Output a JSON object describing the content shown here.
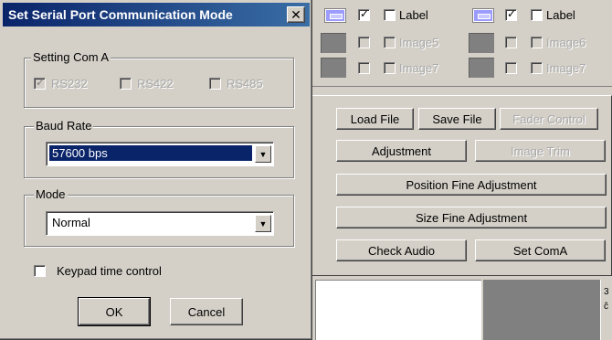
{
  "dialog": {
    "title": "Set Serial Port Communication Mode",
    "close_glyph": "✕",
    "setting_com": {
      "legend": "Setting Com A",
      "options": [
        {
          "label": "RS232",
          "checked": true
        },
        {
          "label": "RS422",
          "checked": false
        },
        {
          "label": "RS485",
          "checked": false
        }
      ]
    },
    "baud_rate": {
      "legend": "Baud Rate",
      "value": "57600 bps"
    },
    "mode": {
      "legend": "Mode",
      "value": "Normal"
    },
    "keypad_label": "Keypad time control",
    "ok_label": "OK",
    "cancel_label": "Cancel"
  },
  "background": {
    "top_rows": [
      {
        "left_label": "Label",
        "right_label": "Label"
      },
      {
        "left_label": "Image5",
        "right_label": "Image6"
      },
      {
        "left_label": "Image7",
        "right_label": "Image7"
      }
    ],
    "check_glyph": "✓",
    "buttons": {
      "load_file": "Load File",
      "save_file": "Save File",
      "fader_control": "Fader Control",
      "adjustment": "Adjustment",
      "image_trim": "Image Trim",
      "position_fine": "Position Fine Adjustment",
      "size_fine": "Size Fine Adjustment",
      "check_audio": "Check Audio",
      "set_com_a": "Set ComA"
    },
    "strip_glyph": "3\nĉ"
  },
  "colors": {
    "titlebar_start": "#0a246a",
    "titlebar_end": "#3a6ea5",
    "face": "#d4d0c8",
    "selection": "#0a246a"
  }
}
